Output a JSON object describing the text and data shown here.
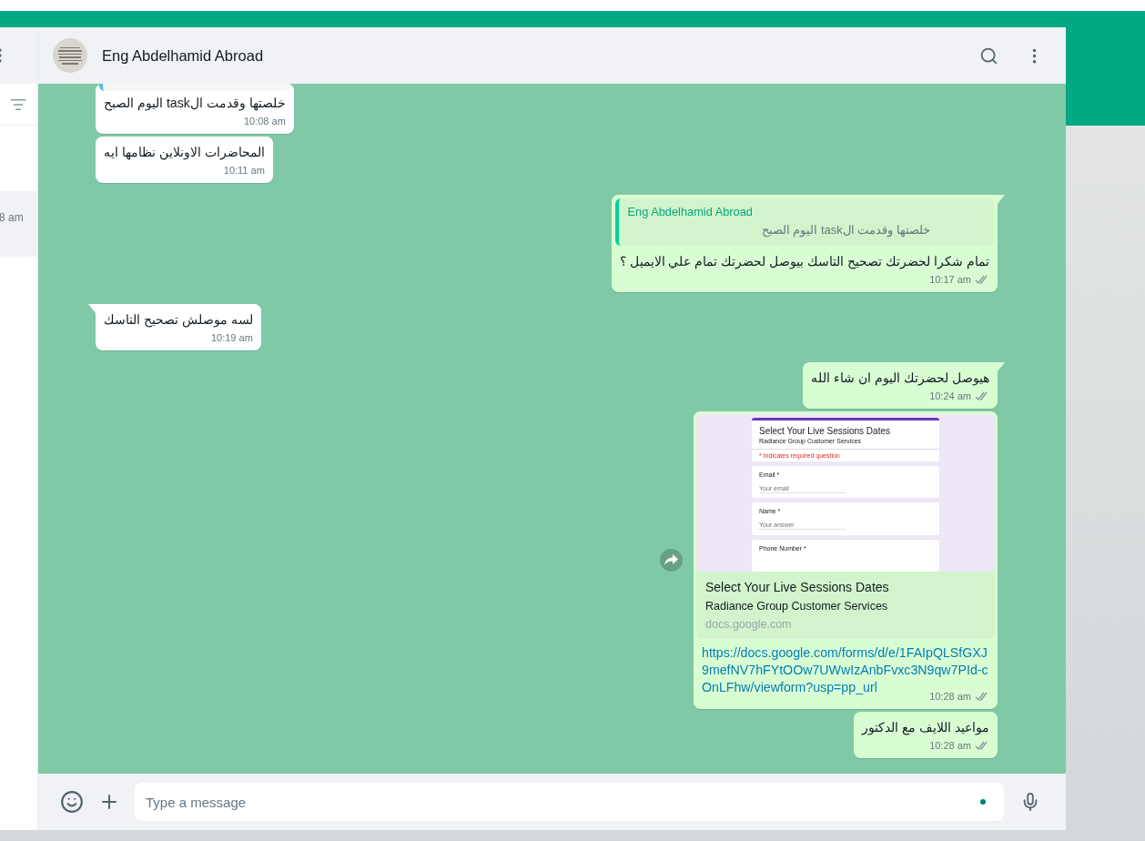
{
  "sidebar": {
    "items": [
      {
        "time": "8 am",
        "selected": true
      }
    ]
  },
  "chat": {
    "contact": "Eng Abdelhamid Abroad",
    "messages": [
      {
        "kind": "text",
        "outgoing": false,
        "text": "خلصتها وقدمت الtask اليوم الصبح",
        "time": "10:08 am",
        "cut_quote": true
      },
      {
        "kind": "text",
        "outgoing": false,
        "text": "المحاضرات الاونلاين نظامها ايه",
        "time": "10:11 am"
      },
      {
        "kind": "reply",
        "outgoing": true,
        "quote": {
          "author": "Eng Abdelhamid Abroad",
          "text": "خلصتها وقدمت الtask اليوم الصبح"
        },
        "text": "تمام شكرا لحضرتك تصحيح التاسك بيوصل لحضرتك تمام علي الايميل ؟",
        "time": "10:17 am",
        "read": false
      },
      {
        "kind": "text",
        "outgoing": false,
        "text": "لسه موصلش تصحيح التاسك",
        "time": "10:19 am"
      },
      {
        "kind": "text",
        "outgoing": true,
        "text": "هيوصل لحضرتك اليوم ان شاء الله",
        "time": "10:24 am",
        "read": false
      },
      {
        "kind": "link",
        "outgoing": true,
        "preview": {
          "form": {
            "title": "Select Your Live Sessions Dates",
            "subtitle": "Radiance Group Customer Services",
            "note": "* Indicates required question",
            "fields": [
              {
                "label": "Email *",
                "placeholder": "Your email"
              },
              {
                "label": "Name *",
                "placeholder": "Your answer"
              },
              {
                "label": "Phone Number *"
              }
            ]
          },
          "title": "Select Your Live Sessions Dates",
          "description": "Radiance Group Customer Services",
          "domain": "docs.google.com"
        },
        "url": "https://docs.google.com/forms/d/e/1FAIpQLSfGXJ9mefNV7hFYtOOw7UWwIzAnbFvxc3N9qw7PId-cOnLFhw/viewform?usp=pp_url",
        "time": "10:28 am",
        "read": false
      },
      {
        "kind": "text",
        "outgoing": true,
        "text": "مواعيد اللايف مع الدكتور",
        "time": "10:28 am",
        "read": false
      }
    ]
  },
  "composer": {
    "placeholder": "Type a message"
  }
}
